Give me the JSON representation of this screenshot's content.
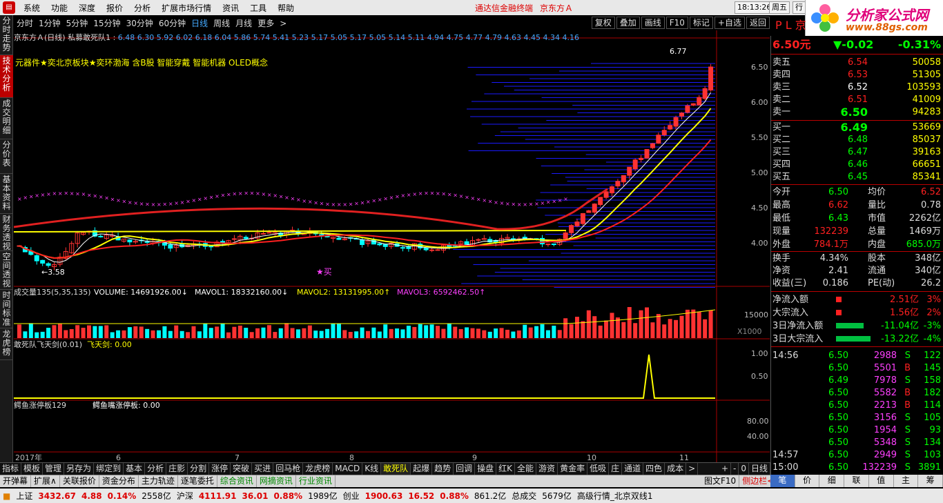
{
  "menu": {
    "items": [
      "系统",
      "功能",
      "深度",
      "报价",
      "分析",
      "扩展市场行情",
      "资讯",
      "工具",
      "帮助"
    ],
    "title_app": "通达信金融终端",
    "title_stock": "京东方Ａ",
    "time": "18:13:26",
    "weekday": "周五",
    "xing": "行"
  },
  "ad": {
    "line1": "分析家公式网",
    "line2": "www.88gs.com"
  },
  "left_tabs": [
    "分时走势",
    "技术分析",
    "成交明细",
    "分价表",
    "基本资料",
    "财务透视",
    "空间透视",
    "时间标准",
    "龙虎榜"
  ],
  "period_tabs": [
    "分时",
    "1分钟",
    "5分钟",
    "15分钟",
    "30分钟",
    "60分钟",
    "日线",
    "周线",
    "月线",
    "更多",
    ">"
  ],
  "period_active": "日线",
  "toolbar_right": [
    "复权",
    "叠加",
    "画线",
    "F10",
    "标记",
    "+自选",
    "返回"
  ],
  "chart_header": {
    "name": "京东方Ａ(日线) 私募敢死队1",
    "prices": "6.48  6.30  5.92  6.02  6.18  6.04  5.86  5.74  5.41  5.23  5.17  5.05  5.17  5.05  5.14  5.11  4.94  4.75  4.77  4.79  4.63  4.45  4.34  4.16"
  },
  "concept": "元器件★奕北京板块★奕环渤海 含B股 智能穿戴 智能机器 OLED概念",
  "price_labels": {
    "high": "6.77",
    "low": "3.58",
    "buy": "★买"
  },
  "y_axis": [
    "6.50",
    "6.00",
    "5.50",
    "5.00",
    "4.50",
    "4.00"
  ],
  "vol_header": {
    "label": "成交量135(5,35,135)",
    "volume": "VOLUME: 14691926.00",
    "mavol1": "MAVOL1: 18332160.00",
    "mavol2": "MAVOL2: 13131995.00",
    "mavol3": "MAVOL3: 6592462.50"
  },
  "vol_axis": [
    "15000",
    "X1000"
  ],
  "ind1": {
    "label": "敢死队飞天剑(0.01)",
    "value": "飞天剑: 0.00",
    "axis": [
      "1.00",
      "0.50"
    ]
  },
  "ind2": {
    "label": "鳄鱼涨停板129",
    "value": "鳄鱼嘴涨停板: 0.00",
    "axis": [
      "80.00",
      "40.00"
    ]
  },
  "x_axis": [
    "2017年",
    "6",
    "7",
    "8",
    "9",
    "10",
    "11"
  ],
  "rightpanel": {
    "code": "P L 京",
    "price": "6.50元",
    "change": "▼-0.02",
    "pct": "-0.31%",
    "sell": [
      [
        "卖五",
        "6.54",
        "50058"
      ],
      [
        "卖四",
        "6.53",
        "51305"
      ],
      [
        "卖三",
        "6.52",
        "103593"
      ],
      [
        "卖二",
        "6.51",
        "41009"
      ],
      [
        "卖一",
        "6.50",
        "94283"
      ]
    ],
    "buy": [
      [
        "买一",
        "6.49",
        "53669"
      ],
      [
        "买二",
        "6.48",
        "85037"
      ],
      [
        "买三",
        "6.47",
        "39163"
      ],
      [
        "买四",
        "6.46",
        "66651"
      ],
      [
        "买五",
        "6.45",
        "85341"
      ]
    ],
    "stats": [
      [
        "今开",
        "6.50",
        "均价",
        "6.52"
      ],
      [
        "最高",
        "6.62",
        "量比",
        "0.78"
      ],
      [
        "最低",
        "6.43",
        "市值",
        "2262亿"
      ],
      [
        "现量",
        "132239",
        "总量",
        "1469万"
      ],
      [
        "外盘",
        "784.1万",
        "内盘",
        "685.0万"
      ]
    ],
    "stats2": [
      [
        "换手",
        "4.34%",
        "股本",
        "348亿"
      ],
      [
        "净资",
        "2.41",
        "流通",
        "340亿"
      ],
      [
        "收益(三)",
        "0.186",
        "PE(动)",
        "26.2"
      ]
    ],
    "flows": [
      [
        "净流入额",
        "2.51亿",
        "3%"
      ],
      [
        "大宗流入",
        "1.56亿",
        "2%"
      ],
      [
        "3日净流入额",
        "-11.04亿",
        "-3%"
      ],
      [
        "3日大宗流入",
        "-13.22亿",
        "-4%"
      ]
    ],
    "ticks": [
      [
        "14:56",
        "6.50",
        "2988",
        "S",
        "122"
      ],
      [
        "",
        "6.50",
        "5501",
        "B",
        "145"
      ],
      [
        "",
        "6.49",
        "7978",
        "S",
        "158"
      ],
      [
        "",
        "6.50",
        "5582",
        "B",
        "182"
      ],
      [
        "",
        "6.50",
        "2213",
        "B",
        "114"
      ],
      [
        "",
        "6.50",
        "3156",
        "S",
        "105"
      ],
      [
        "",
        "6.50",
        "1954",
        "S",
        "93"
      ],
      [
        "",
        "6.50",
        "5348",
        "S",
        "134"
      ],
      [
        "14:57",
        "6.50",
        "2949",
        "S",
        "103"
      ],
      [
        "15:00",
        "6.50",
        "132239",
        "S",
        "3891"
      ]
    ]
  },
  "bottom_tabs": [
    "指标",
    "模板",
    "管理",
    "另存为",
    "绑定到",
    "基本",
    "分析",
    "庄影",
    "分割",
    "涨停",
    "突破",
    "买进",
    "回马枪",
    "龙虎榜",
    "MACD",
    "K线",
    "敢死队",
    "起爆",
    "趋势",
    "回调",
    "操盘",
    "红K",
    "全能",
    "游资",
    "黄金率",
    "低吸",
    "庄",
    "通道",
    "四色",
    "成本",
    ">"
  ],
  "bottom_tab_sel": "敢死队",
  "bottom_right": [
    "+",
    "-",
    "0",
    "日线"
  ],
  "bottom_tabs2": [
    "开弹幕",
    "扩展∧",
    "关联报价",
    "资金分布",
    "主力轨迹",
    "逐笔委托",
    "综合资讯",
    "网摘资讯",
    "行业资讯"
  ],
  "bottom_tabs2_right": [
    "图文F10",
    "侧边栏<"
  ],
  "right_tabs": [
    "笔",
    "价",
    "细",
    "联",
    "值",
    "主",
    "筹"
  ],
  "status": [
    [
      "上证",
      "3432.67",
      "4.88",
      "0.14%",
      "2558亿"
    ],
    [
      "沪深",
      "4111.91",
      "36.01",
      "0.88%",
      "1989亿"
    ],
    [
      "创业",
      "1900.63",
      "16.52",
      "0.88%",
      "861.2亿"
    ]
  ],
  "status_extra": {
    "total_label": "总成交",
    "total": "5679亿",
    "quote": "高级行情_北京双线1"
  },
  "colors": {
    "up": "#ff3232",
    "down": "#00ffff",
    "ma_white": "#ffffff",
    "ma_yellow": "#ffff00",
    "ma_red": "#ff2020",
    "profile": "#1a1aff",
    "magenta": "#ff40ff"
  }
}
